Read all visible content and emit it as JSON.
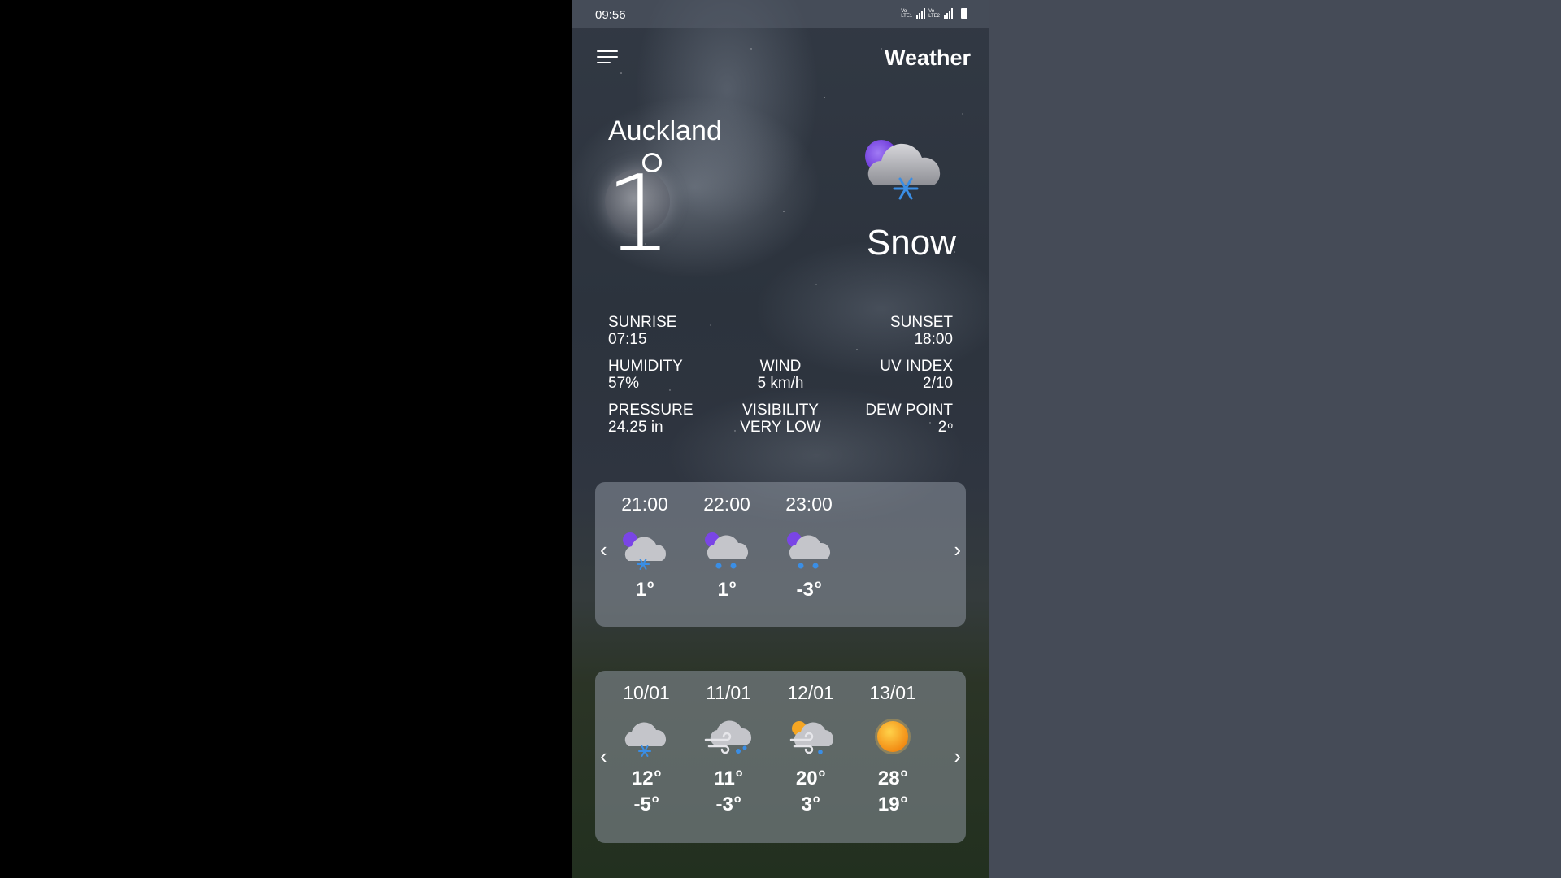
{
  "status_bar": {
    "time": "09:56",
    "lte1": "VoLTE1",
    "lte2": "VoLTE2"
  },
  "header": {
    "title": "Weather",
    "menu_icon": "hamburger-menu-icon"
  },
  "current": {
    "city": "Auckland",
    "temperature": "1",
    "condition": "Snow",
    "icon": "night-snow-cloud-icon"
  },
  "details": {
    "sunrise": {
      "label": "SUNRISE",
      "value": "07:15"
    },
    "sunset": {
      "label": "SUNSET",
      "value": "18:00"
    },
    "humidity": {
      "label": "HUMIDITY",
      "value": "57%"
    },
    "wind": {
      "label": "WIND",
      "value": "5 km/h"
    },
    "uv_index": {
      "label": "UV INDEX",
      "value": "2/10"
    },
    "pressure": {
      "label": "PRESSURE",
      "value": "24.25 in"
    },
    "visibility": {
      "label": "VISIBILITY",
      "value": "VERY LOW"
    },
    "dew_point": {
      "label": "DEW POINT",
      "value": "2"
    }
  },
  "hourly": {
    "prev_arrow": "‹",
    "next_arrow": "›",
    "items": [
      {
        "time": "21:00",
        "temp": "1",
        "icon": "night-snow-cloud-icon"
      },
      {
        "time": "22:00",
        "temp": "1",
        "icon": "night-snow-cloud-icon"
      },
      {
        "time": "23:00",
        "temp": "-3",
        "icon": "night-snow-cloud-icon"
      }
    ]
  },
  "daily": {
    "prev_arrow": "‹",
    "next_arrow": "›",
    "items": [
      {
        "date": "10/01",
        "high": "12",
        "low": "-5",
        "icon": "snow-cloud-icon"
      },
      {
        "date": "11/01",
        "high": "11",
        "low": "-3",
        "icon": "wind-snow-cloud-icon"
      },
      {
        "date": "12/01",
        "high": "20",
        "low": "3",
        "icon": "sun-wind-snow-cloud-icon"
      },
      {
        "date": "13/01",
        "high": "28",
        "low": "19",
        "icon": "sun-icon"
      }
    ]
  },
  "colors": {
    "panel": "#8c949e",
    "snowflake": "#3a8ee6",
    "moon": "#7a45e6",
    "sun": "#f5a623"
  }
}
